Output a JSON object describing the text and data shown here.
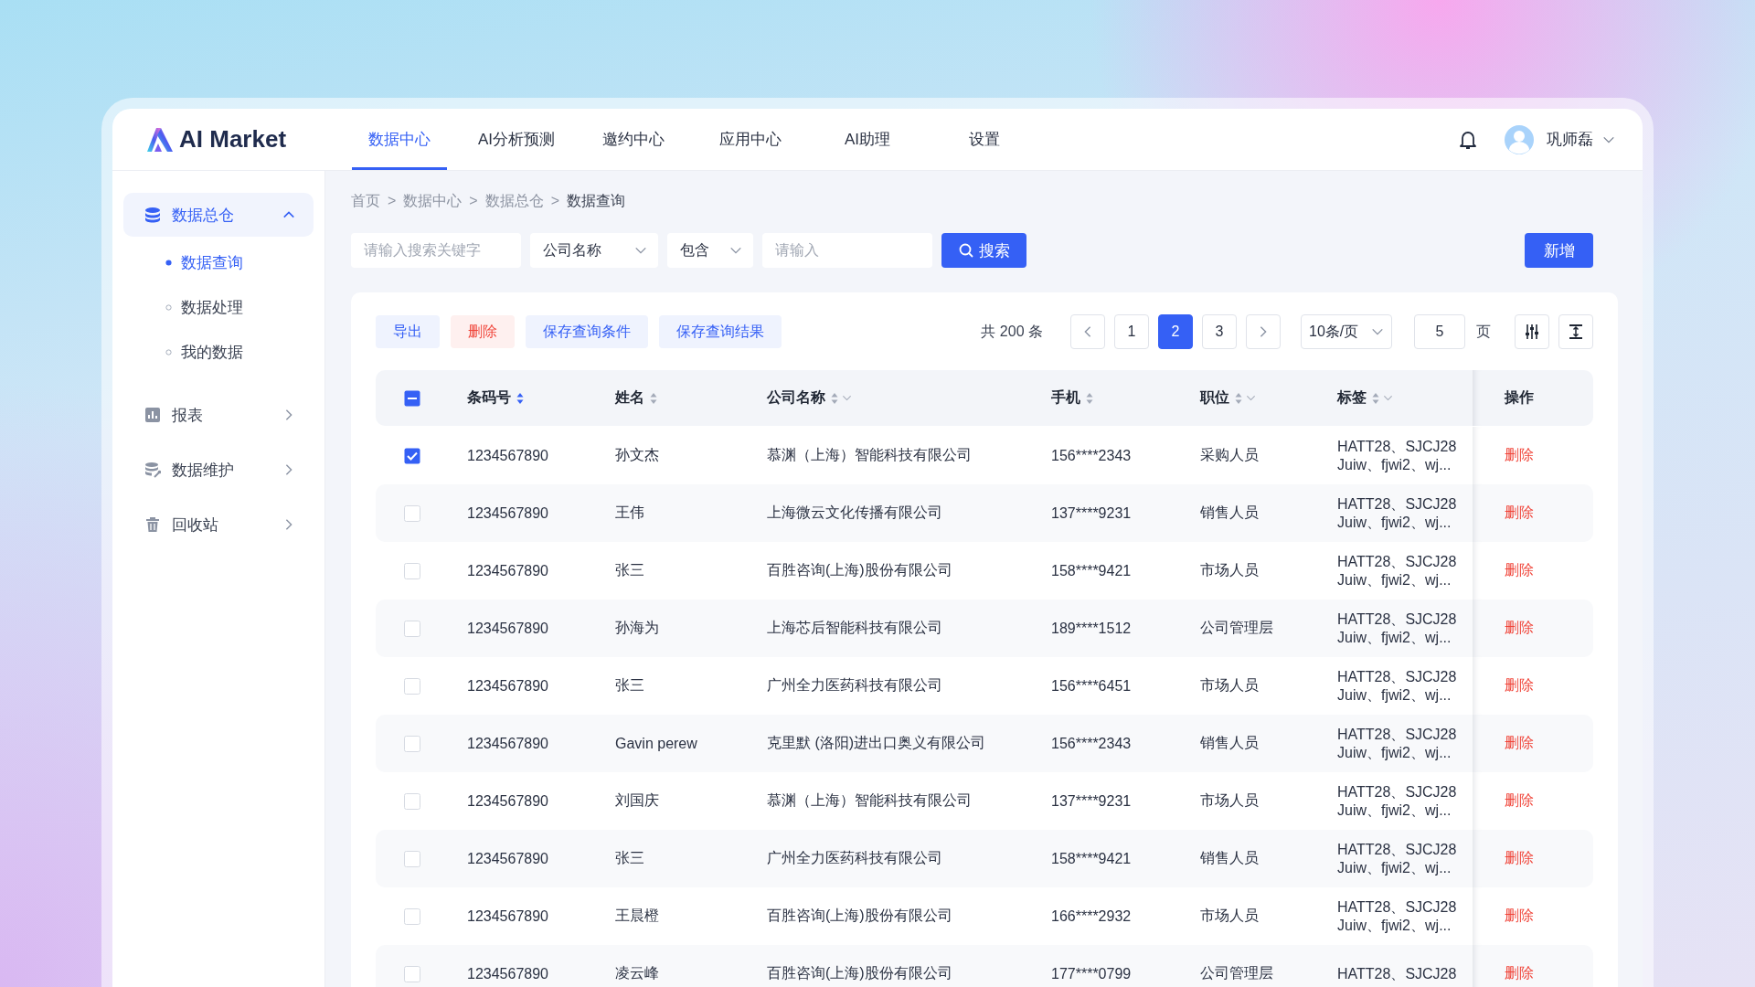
{
  "header": {
    "logo_text": "AI Market",
    "nav_tabs": [
      {
        "label": "数据中心",
        "selected": true
      },
      {
        "label": "AI分析预测",
        "selected": false
      },
      {
        "label": "邀约中心",
        "selected": false
      },
      {
        "label": "应用中心",
        "selected": false
      },
      {
        "label": "AI助理",
        "selected": false
      },
      {
        "label": "设置",
        "selected": false
      }
    ],
    "user": {
      "name": "巩师磊"
    }
  },
  "sidebar": {
    "items": [
      {
        "label": "数据总仓",
        "kind": "database",
        "expanded": true,
        "selected": true,
        "children": [
          {
            "label": "数据查询",
            "selected": true
          },
          {
            "label": "数据处理",
            "selected": false
          },
          {
            "label": "我的数据",
            "selected": false
          }
        ]
      },
      {
        "label": "报表",
        "kind": "chart",
        "expanded": false,
        "selected": false
      },
      {
        "label": "数据维护",
        "kind": "maintenance",
        "expanded": false,
        "selected": false
      },
      {
        "label": "回收站",
        "kind": "trash",
        "expanded": false,
        "selected": false
      }
    ]
  },
  "breadcrumb": {
    "separator": ">",
    "items": [
      "首页",
      "数据中心",
      "数据总仓",
      "数据查询"
    ]
  },
  "filters": {
    "keyword": {
      "placeholder": "请输入搜索关键字"
    },
    "field": {
      "value": "公司名称"
    },
    "operator": {
      "value": "包含"
    },
    "value": {
      "placeholder": "请输入"
    },
    "search_button": "搜索",
    "add_button": "新增"
  },
  "actions": [
    {
      "label": "导出",
      "kind": "normal"
    },
    {
      "label": "删除",
      "kind": "danger"
    },
    {
      "label": "保存查询条件",
      "kind": "normal"
    },
    {
      "label": "保存查询结果",
      "kind": "normal"
    }
  ],
  "pagination": {
    "total": "共 200 条",
    "pages": [
      {
        "label": "1",
        "selected": false
      },
      {
        "label": "2",
        "selected": true
      },
      {
        "label": "3",
        "selected": false
      }
    ],
    "page_size": "10条/页",
    "jump_value": "5",
    "jump_suffix": "页"
  },
  "table": {
    "select_all": {
      "checked": true,
      "indeterminate": true
    },
    "columns": [
      {
        "label": "条码号",
        "sortable": true,
        "sort_active": true,
        "filterable": false
      },
      {
        "label": "姓名",
        "sortable": true,
        "sort_active": false,
        "filterable": false
      },
      {
        "label": "公司名称",
        "sortable": true,
        "sort_active": false,
        "filterable": true
      },
      {
        "label": "手机",
        "sortable": true,
        "sort_active": false,
        "filterable": false
      },
      {
        "label": "职位",
        "sortable": true,
        "sort_active": false,
        "filterable": true
      },
      {
        "label": "标签",
        "sortable": true,
        "sort_active": false,
        "filterable": true
      },
      {
        "label": "操作",
        "sortable": false,
        "sort_active": false,
        "filterable": false
      }
    ],
    "rows": [
      {
        "selected": true,
        "cells": [
          "1234567890",
          "孙文杰",
          "慕渊（上海）智能科技有限公司",
          "156****2343",
          "采购人员"
        ],
        "tags": [
          "HATT28、SJCJ28",
          "Juiw、fjwi2、wj..."
        ],
        "action": "删除"
      },
      {
        "selected": false,
        "cells": [
          "1234567890",
          "王伟",
          "上海微云文化传播有限公司",
          "137****9231",
          "销售人员"
        ],
        "tags": [
          "HATT28、SJCJ28",
          "Juiw、fjwi2、wj..."
        ],
        "action": "删除"
      },
      {
        "selected": false,
        "cells": [
          "1234567890",
          "张三",
          "百胜咨询(上海)股份有限公司",
          "158****9421",
          "市场人员"
        ],
        "tags": [
          "HATT28、SJCJ28",
          "Juiw、fjwi2、wj..."
        ],
        "action": "删除"
      },
      {
        "selected": false,
        "cells": [
          "1234567890",
          "孙海为",
          "上海芯后智能科技有限公司",
          "189****1512",
          "公司管理层"
        ],
        "tags": [
          "HATT28、SJCJ28",
          "Juiw、fjwi2、wj..."
        ],
        "action": "删除"
      },
      {
        "selected": false,
        "cells": [
          "1234567890",
          "张三",
          "广州全力医药科技有限公司",
          "156****6451",
          "市场人员"
        ],
        "tags": [
          "HATT28、SJCJ28",
          "Juiw、fjwi2、wj..."
        ],
        "action": "删除"
      },
      {
        "selected": false,
        "cells": [
          "1234567890",
          "Gavin perew",
          "克里默 (洛阳)进出口奥义有限公司",
          "156****2343",
          "销售人员"
        ],
        "tags": [
          "HATT28、SJCJ28",
          "Juiw、fjwi2、wj..."
        ],
        "action": "删除"
      },
      {
        "selected": false,
        "cells": [
          "1234567890",
          "刘国庆",
          "慕渊（上海）智能科技有限公司",
          "137****9231",
          "市场人员"
        ],
        "tags": [
          "HATT28、SJCJ28",
          "Juiw、fjwi2、wj..."
        ],
        "action": "删除"
      },
      {
        "selected": false,
        "cells": [
          "1234567890",
          "张三",
          "广州全力医药科技有限公司",
          "158****9421",
          "销售人员"
        ],
        "tags": [
          "HATT28、SJCJ28",
          "Juiw、fjwi2、wj..."
        ],
        "action": "删除"
      },
      {
        "selected": false,
        "cells": [
          "1234567890",
          "王晨橙",
          "百胜咨询(上海)股份有限公司",
          "166****2932",
          "市场人员"
        ],
        "tags": [
          "HATT28、SJCJ28",
          "Juiw、fjwi2、wj..."
        ],
        "action": "删除"
      },
      {
        "selected": false,
        "cells": [
          "1234567890",
          "凌云峰",
          "百胜咨询(上海)股份有限公司",
          "177****0799",
          "公司管理层"
        ],
        "tags": [
          "HATT28、SJCJ28"
        ],
        "action": "删除"
      }
    ]
  }
}
